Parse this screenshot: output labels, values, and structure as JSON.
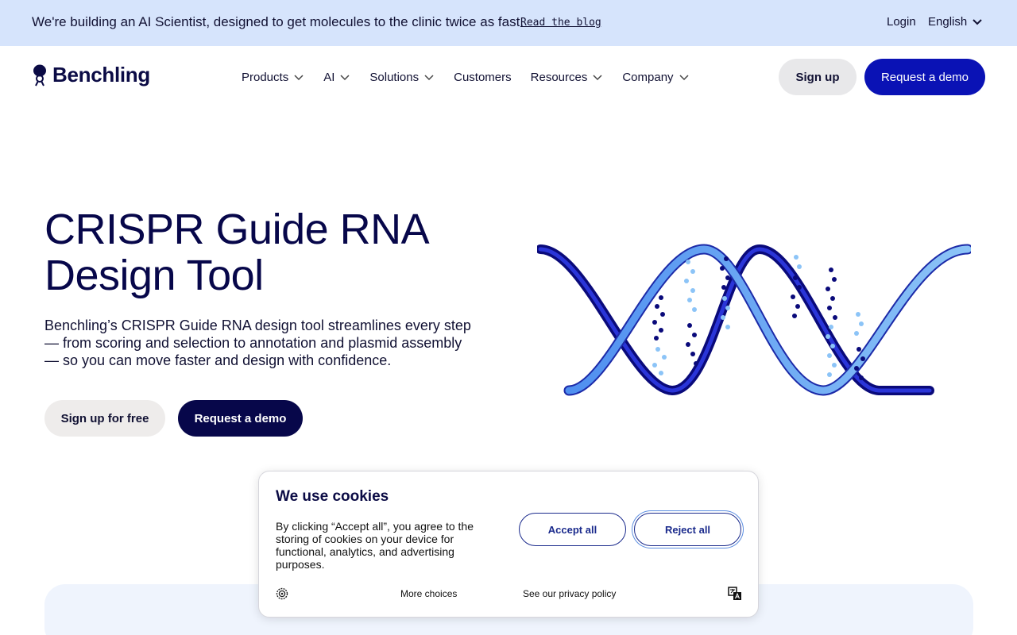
{
  "announcement": {
    "text": "We're building an AI Scientist, designed to get molecules to the clinic twice as fast.",
    "link": "Read the blog",
    "login": "Login",
    "language": "English"
  },
  "header": {
    "logo": "Benchling",
    "nav": [
      "Products",
      "AI",
      "Solutions",
      "Customers",
      "Resources",
      "Company"
    ],
    "signup": "Sign up",
    "demo": "Request a demo"
  },
  "hero": {
    "title": "CRISPR Guide RNA Design Tool",
    "description": "Benchling’s CRISPR Guide RNA design tool streamlines every step — from scoring and selection to annotation and plasmid assembly — so you can move faster and design with confidence.",
    "primary_button": "Sign up for free",
    "secondary_button": "Request a demo"
  },
  "cookie_banner": {
    "title": "We use cookies",
    "text": "By clicking “Accept all”, you agree to the storing of cookies on your device for functional, analytics, and advertising purposes.",
    "accept": "Accept all",
    "reject": "Reject all",
    "more_choices": "More choices",
    "privacy": "See our privacy policy"
  },
  "colors": {
    "announcement_bg": "#d6e4fc",
    "brand_navy": "#07074a",
    "accent_blue": "#0a12b5",
    "helix_light": "#6fb1f2"
  }
}
